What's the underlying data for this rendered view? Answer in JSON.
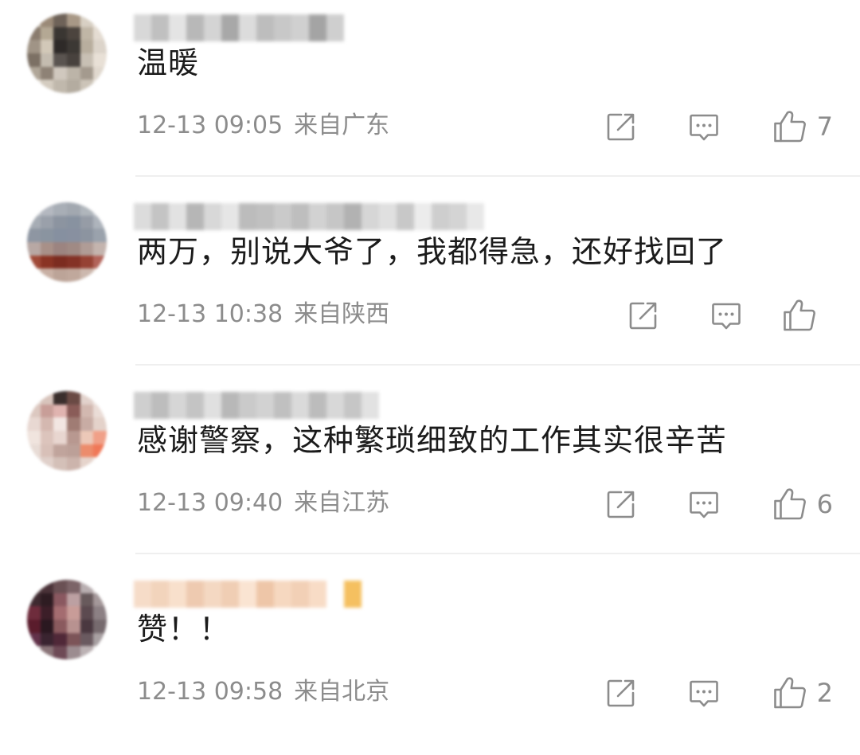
{
  "comments": [
    {
      "text": "温暖",
      "time": "12-13 09:05",
      "location": "来自广东",
      "likes": "7",
      "avatar_colors": [
        "#c8c0b4",
        "#9b8a78",
        "#6e6258",
        "#a89886",
        "#d8d0c4",
        "#ede8e0",
        "#8a7c6e",
        "#b4a894",
        "#3a3632",
        "#4c443e",
        "#c0b6a6",
        "#e4dcd2",
        "#a09486",
        "#d2c8b8",
        "#2e2a28",
        "#3c3834",
        "#b8ae9e",
        "#dcd4ca",
        "#7c7064",
        "#c4bcb0",
        "#5a5450",
        "#48423e",
        "#c8c0b4",
        "#e8e0d6",
        "#b0a698",
        "#8e8276",
        "#d0c8be",
        "#bcb4a8",
        "#a49a8e",
        "#e0d8ce",
        "#e6e0d8",
        "#d4ccc0",
        "#c0b8ac",
        "#b4aca0",
        "#ccc4b8",
        "#ece6de"
      ],
      "username_colors": [
        "#d8d8d8",
        "#c0c0c0",
        "#e4e4e4",
        "#b8b8b8",
        "#d4d4d4",
        "#a8a8a8",
        "#dcdcdc",
        "#bdbdbd",
        "#c8c8c8",
        "#d0d0d0",
        "#a4a4a4",
        "#cfcfcf"
      ]
    },
    {
      "text": "两万，别说大爷了，我都得急，还好找回了",
      "time": "12-13 10:38",
      "location": "来自陕西",
      "likes": "",
      "avatar_colors": [
        "#c2c6cc",
        "#b4b8c0",
        "#a8aeb6",
        "#a2a8b0",
        "#b0b6bc",
        "#c6cad0",
        "#a6acb4",
        "#9aa0aa",
        "#8c94a0",
        "#8892a0",
        "#969ca6",
        "#aeb4bc",
        "#8e96a2",
        "#8a94a0",
        "#8690a0",
        "#8890a0",
        "#8c94a0",
        "#9aa2ac",
        "#b8a8a4",
        "#a89088",
        "#9c8480",
        "#a08a84",
        "#b09c96",
        "#c4b4ae",
        "#a04a38",
        "#8a3424",
        "#7c2c20",
        "#843226",
        "#964234",
        "#b2645a",
        "#d8c6bc",
        "#c8b0a4",
        "#bca498",
        "#c0a89c",
        "#ccb8ae",
        "#e0d2c8"
      ],
      "username_colors": [
        "#dcdcdc",
        "#c4c4c4",
        "#e2e2e2",
        "#b6b6b6",
        "#d8d8d8",
        "#e6e6e6",
        "#bcbcbc",
        "#c0c0c0",
        "#cacaca",
        "#bebebe",
        "#d2d2d2",
        "#c6c6c6",
        "#b2b2b2",
        "#d6d6d6",
        "#e0e0e0",
        "#c8c8c8",
        "#ececec",
        "#cecece",
        "#d4d4d4",
        "#e8e8e8"
      ]
    },
    {
      "text": "感谢警察，这种繁琐细致的工作其实很辛苦",
      "time": "12-13 09:40",
      "location": "来自江苏",
      "likes": "6",
      "avatar_colors": [
        "#e6dad4",
        "#d8c4bc",
        "#3a2e2c",
        "#6a4a44",
        "#e2d2cc",
        "#f0e8e4",
        "#dcc8c0",
        "#c89e98",
        "#e0b4b0",
        "#8a5c58",
        "#d2b8b0",
        "#eadcd6",
        "#e8d8d2",
        "#d4b8b0",
        "#f2e6e2",
        "#a07c74",
        "#c8aca4",
        "#e4d2ca",
        "#f0e4de",
        "#dcc4bc",
        "#e8d6d0",
        "#b89890",
        "#ecc8b8",
        "#f0a088",
        "#e8dcd6",
        "#d8c0b8",
        "#c0a49c",
        "#bca098",
        "#ec8c6c",
        "#f07858",
        "#ece4e0",
        "#e0d0ca",
        "#d4c0b8",
        "#ccb4ac",
        "#e6d4cc",
        "#f0e8e4"
      ],
      "username_colors": [
        "#cfcfcf",
        "#bdbdbd",
        "#d6d6d6",
        "#c4c4c4",
        "#e0e0e0",
        "#b8b8b8",
        "#cacaca",
        "#d2d2d2",
        "#c0c0c0",
        "#dadada",
        "#bcbcbc",
        "#d8d8d8",
        "#c6c6c6",
        "#e2e2e2"
      ]
    },
    {
      "text": "赞！！",
      "time": "12-13 09:58",
      "location": "来自北京",
      "likes": "2",
      "avatar_colors": [
        "#5a4448",
        "#4a3238",
        "#6a5054",
        "#7c6468",
        "#b8aeb0",
        "#e4dede",
        "#3e2a30",
        "#2e1c22",
        "#8a5860",
        "#bca0a2",
        "#685a5c",
        "#a4989a",
        "#6e2c3c",
        "#3c1e28",
        "#a46c70",
        "#c89c98",
        "#5c4a50",
        "#8c8084",
        "#5a1c2c",
        "#2a1820",
        "#8a5a5e",
        "#b89290",
        "#4a3840",
        "#766a6e",
        "#62324a",
        "#3a2430",
        "#502838",
        "#7c5458",
        "#6a5a60",
        "#a8a0a2",
        "#c4bcbe",
        "#8a7478",
        "#6e4a56",
        "#9c8c90",
        "#bcb2b4",
        "#e8e4e4"
      ],
      "username_colors": [
        "#f6dcc8",
        "#f2d4bc",
        "#f8e0cc",
        "#eecab0",
        "#f4d8c2",
        "#f0ceb4",
        "#fae4d2",
        "#eec6a8",
        "#f6d8c0",
        "#f2d0b6",
        "#f8dcc6",
        "#ffffff",
        "#f5c060"
      ]
    }
  ],
  "icons": {
    "share": "share-icon",
    "comment": "comment-icon",
    "like": "thumbs-up-icon"
  }
}
